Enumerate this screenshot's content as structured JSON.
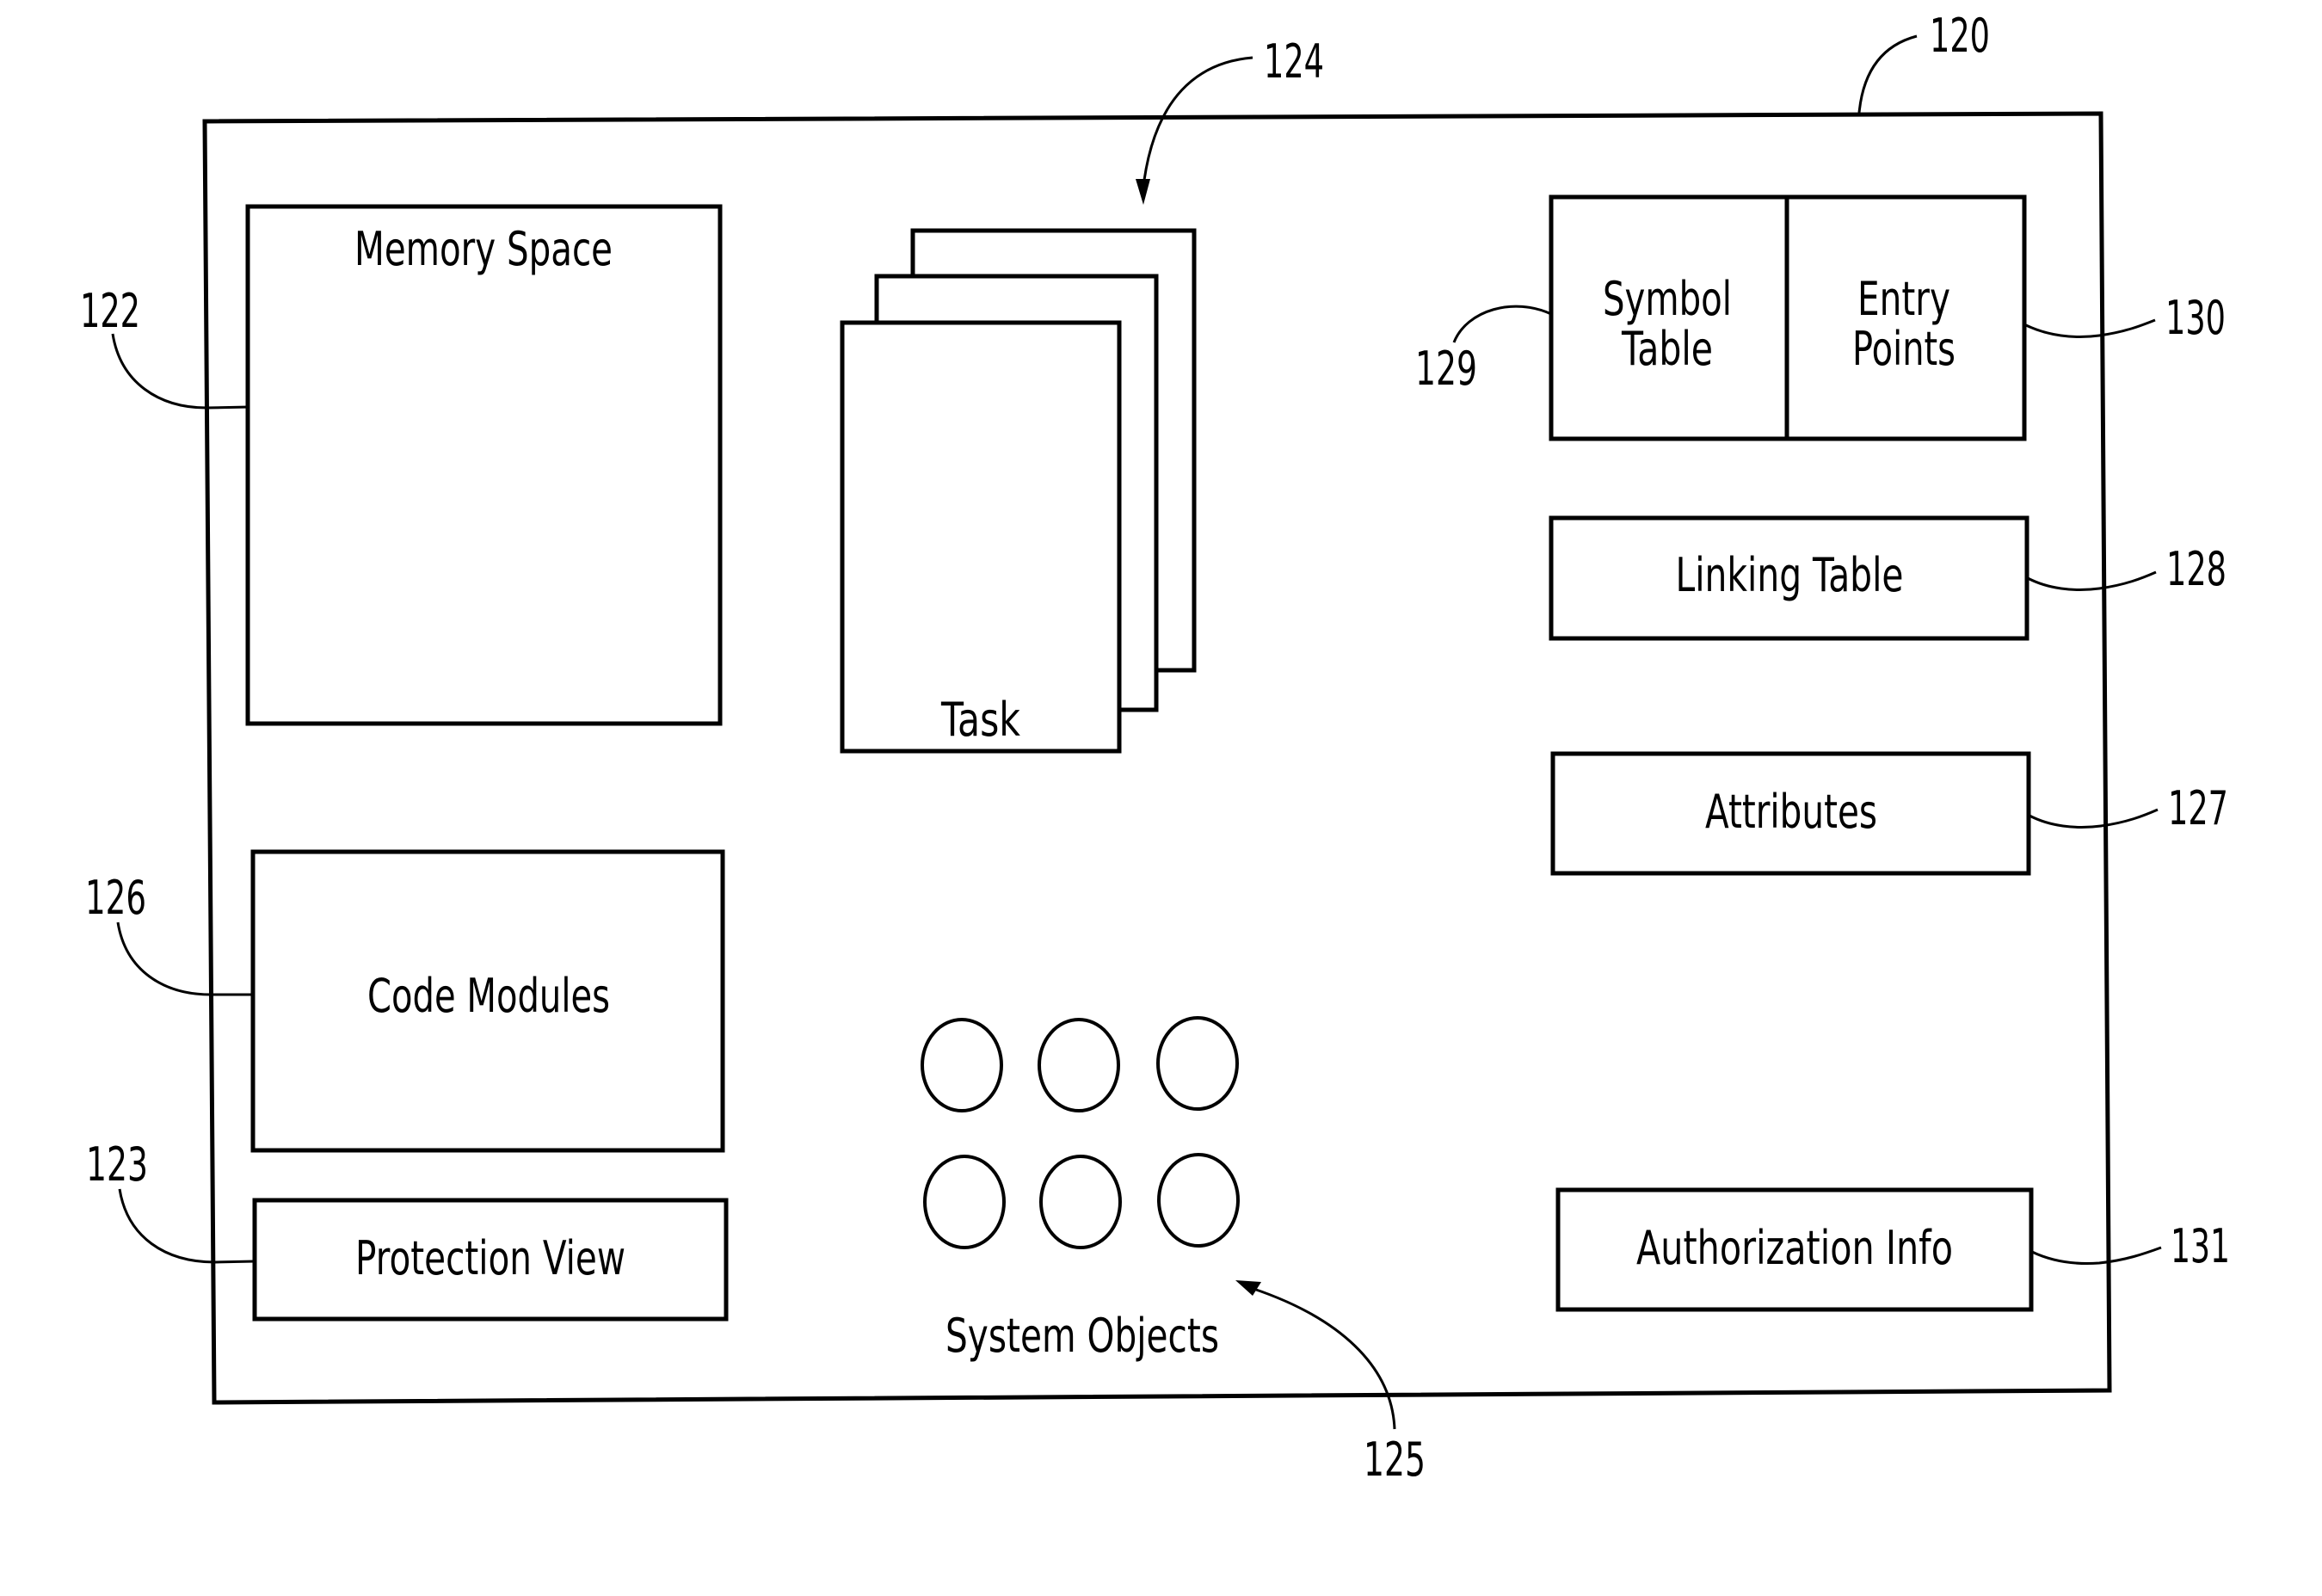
{
  "figure": {
    "container": {
      "label": "",
      "ref": "120"
    },
    "memory_space": {
      "label": "Memory Space",
      "ref": "122"
    },
    "task": {
      "label": "Task",
      "ref": "124",
      "card_count": 3
    },
    "symbol_table": {
      "line1": "Symbol",
      "line2": "Table",
      "ref": "129"
    },
    "entry_points": {
      "line1": "Entry",
      "line2": "Points",
      "ref": "130"
    },
    "linking_table": {
      "label": "Linking Table",
      "ref": "128"
    },
    "attributes": {
      "label": "Attributes",
      "ref": "127"
    },
    "code_modules": {
      "label": "Code Modules",
      "ref": "126"
    },
    "protection_view": {
      "label": "Protection View",
      "ref": "123"
    },
    "system_objects": {
      "label": "System Objects",
      "ref": "125",
      "object_count": 6
    },
    "authorization_info": {
      "label": "Authorization Info",
      "ref": "131"
    }
  }
}
